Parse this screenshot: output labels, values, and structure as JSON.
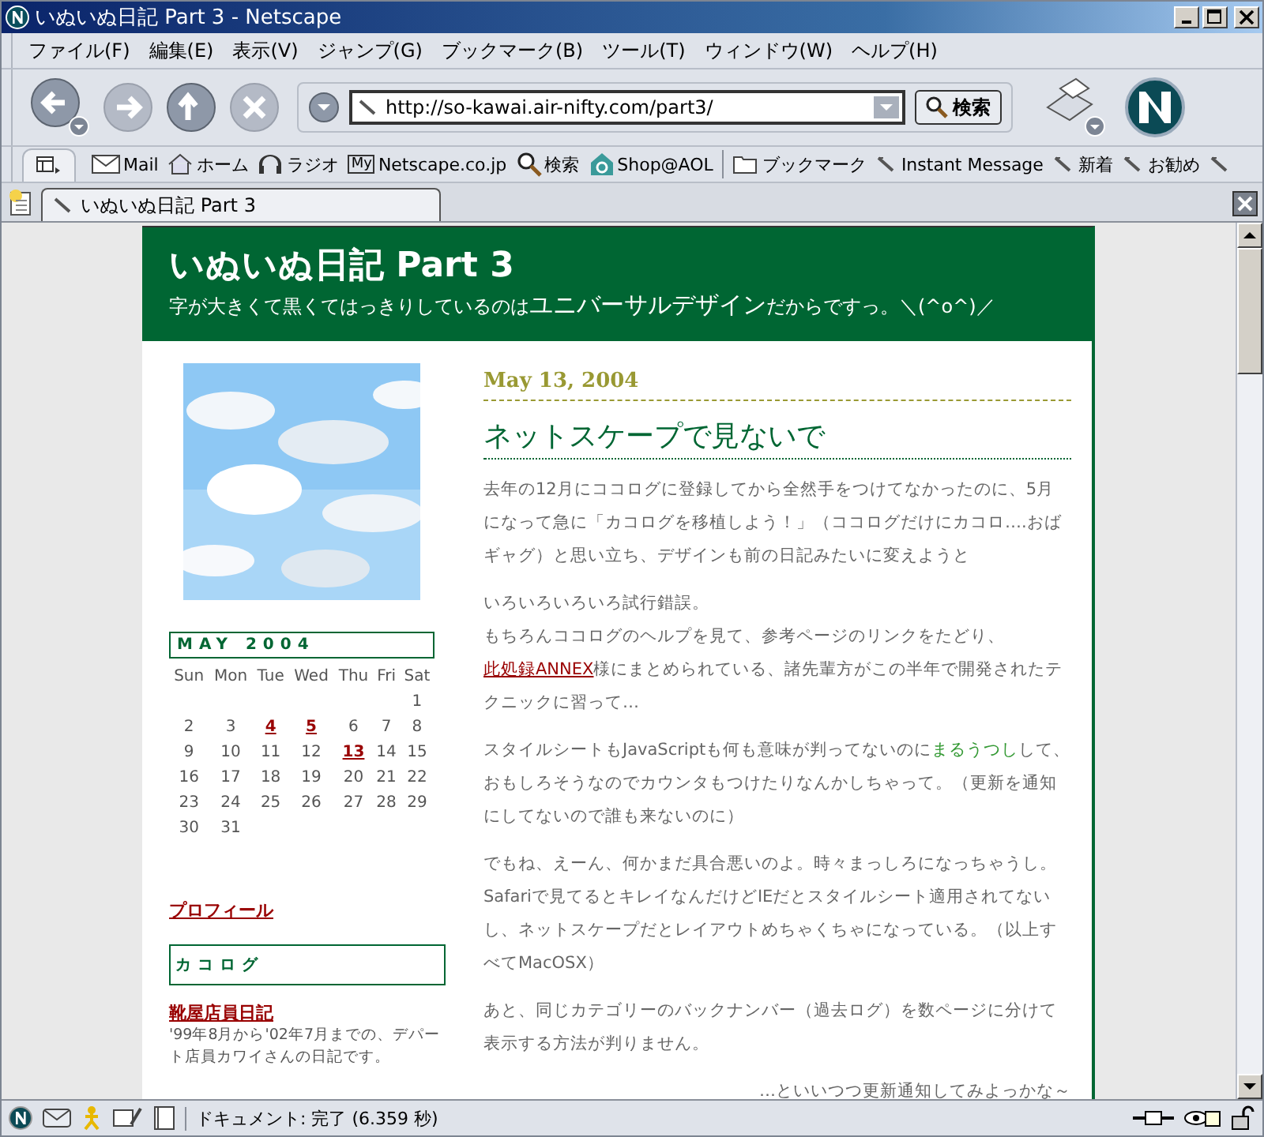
{
  "window": {
    "title": "いぬいぬ日記 Part 3 - Netscape"
  },
  "menu": [
    "ファイル(F)",
    "編集(E)",
    "表示(V)",
    "ジャンプ(G)",
    "ブックマーク(B)",
    "ツール(T)",
    "ウィンドウ(W)",
    "ヘルプ(H)"
  ],
  "navigation": {
    "url": "http://so-kawai.air-nifty.com/part3/",
    "search_button": "検索"
  },
  "personal_toolbar": [
    {
      "kind": "mail",
      "label": "Mail"
    },
    {
      "kind": "home",
      "label": "ホーム"
    },
    {
      "kind": "radio",
      "label": "ラジオ"
    },
    {
      "kind": "my",
      "label": "Netscape.co.jp",
      "icon_text": "My"
    },
    {
      "kind": "search",
      "label": "検索"
    },
    {
      "kind": "shop",
      "label": "Shop@AOL"
    },
    {
      "kind": "folder",
      "label": "ブックマーク"
    },
    {
      "kind": "bookmark",
      "label": "Instant Message"
    },
    {
      "kind": "bookmark",
      "label": "新着"
    },
    {
      "kind": "bookmark",
      "label": "お勧め"
    },
    {
      "kind": "bookmark"
    }
  ],
  "tabs": [
    {
      "label": "いぬいぬ日記 Part 3",
      "selected": true
    }
  ],
  "page": {
    "title": "いぬいぬ日記 Part 3",
    "subtitle": [
      {
        "kind": "text",
        "text": "字が大きくて黒くてはっきりしているのは"
      },
      {
        "kind": "large",
        "text": "ユニバーサルデザイン"
      },
      {
        "kind": "text",
        "text": "だからですっ。＼(^o^)／"
      }
    ],
    "calendar": {
      "title": "MAY 2004",
      "weekdays": [
        "Sun",
        "Mon",
        "Tue",
        "Wed",
        "Thu",
        "Fri",
        "Sat"
      ],
      "weeks": [
        [
          {
            "kind": "blank"
          },
          {
            "kind": "blank"
          },
          {
            "kind": "blank"
          },
          {
            "kind": "blank"
          },
          {
            "kind": "blank"
          },
          {
            "kind": "blank"
          },
          {
            "kind": "day",
            "day": "1",
            "link": false
          }
        ],
        [
          {
            "kind": "day",
            "day": "2",
            "link": false
          },
          {
            "kind": "day",
            "day": "3",
            "link": false
          },
          {
            "kind": "day",
            "day": "4",
            "link": true
          },
          {
            "kind": "day",
            "day": "5",
            "link": true
          },
          {
            "kind": "day",
            "day": "6",
            "link": false
          },
          {
            "kind": "day",
            "day": "7",
            "link": false
          },
          {
            "kind": "day",
            "day": "8",
            "link": false
          }
        ],
        [
          {
            "kind": "day",
            "day": "9",
            "link": false
          },
          {
            "kind": "day",
            "day": "10",
            "link": false
          },
          {
            "kind": "day",
            "day": "11",
            "link": false
          },
          {
            "kind": "day",
            "day": "12",
            "link": false
          },
          {
            "kind": "day",
            "day": "13",
            "link": true
          },
          {
            "kind": "day",
            "day": "14",
            "link": false
          },
          {
            "kind": "day",
            "day": "15",
            "link": false
          }
        ],
        [
          {
            "kind": "day",
            "day": "16",
            "link": false
          },
          {
            "kind": "day",
            "day": "17",
            "link": false
          },
          {
            "kind": "day",
            "day": "18",
            "link": false
          },
          {
            "kind": "day",
            "day": "19",
            "link": false
          },
          {
            "kind": "day",
            "day": "20",
            "link": false
          },
          {
            "kind": "day",
            "day": "21",
            "link": false
          },
          {
            "kind": "day",
            "day": "22",
            "link": false
          }
        ],
        [
          {
            "kind": "day",
            "day": "23",
            "link": false
          },
          {
            "kind": "day",
            "day": "24",
            "link": false
          },
          {
            "kind": "day",
            "day": "25",
            "link": false
          },
          {
            "kind": "day",
            "day": "26",
            "link": false
          },
          {
            "kind": "day",
            "day": "27",
            "link": false
          },
          {
            "kind": "day",
            "day": "28",
            "link": false
          },
          {
            "kind": "day",
            "day": "29",
            "link": false
          }
        ],
        [
          {
            "kind": "day",
            "day": "30",
            "link": false
          },
          {
            "kind": "day",
            "day": "31",
            "link": false
          }
        ]
      ]
    },
    "profile_link": "プロフィール",
    "archive": {
      "heading": "カコログ",
      "link": "靴屋店員日記",
      "description": "'99年8月から'02年7月までの、デパート店員カワイさんの日記です。"
    },
    "post": {
      "date": "May 13, 2004",
      "title": "ネットスケープで見ないで",
      "paragraphs": [
        [
          {
            "kind": "text",
            "text": "去年の12月にココログに登録してから全然手をつけてなかったのに、5月になって急に「カコログを移植しよう！」（ココログだけにカコロ….おばギャグ）と思い立ち、デザインも前の日記みたいに変えようと"
          }
        ],
        [
          {
            "kind": "text",
            "text": "いろいろいろいろ試行錯誤。"
          },
          {
            "kind": "break"
          },
          {
            "kind": "text",
            "text": "もちろんココログのヘルプを見て、参考ページのリンクをたどり、"
          },
          {
            "kind": "link",
            "text": "此処録ANNEX"
          },
          {
            "kind": "text",
            "text": "様にまとめられている、諸先輩方がこの半年で開発されたテクニックに習って…"
          }
        ],
        [
          {
            "kind": "text",
            "text": "スタイルシートもJavaScriptも何も意味が判ってないのに"
          },
          {
            "kind": "green",
            "text": "まるうつし"
          },
          {
            "kind": "text",
            "text": "して、おもしろそうなのでカウンタもつけたりなんかしちゃって。（更新を通知にしてないので誰も来ないのに）"
          }
        ],
        [
          {
            "kind": "text",
            "text": "でもね、えーん、何かまだ具合悪いのよ。時々まっしろになっちゃうし。Safariで見てるとキレイなんだけどIEだとスタイルシート適用されてないし、ネットスケープだとレイアウトめちゃくちゃになっている。（以上すべてMacOSX）"
          }
        ],
        [
          {
            "kind": "text",
            "text": "あと、同じカテゴリーのバックナンバー（過去ログ）を数ページに分けて表示する方法が判りません。"
          }
        ],
        [
          {
            "kind": "aside",
            "text": "…といいつつ更新通知してみよっかな～"
          }
        ]
      ]
    }
  },
  "status_bar": {
    "text": "ドキュメント: 完了 (6.359 秒)"
  }
}
